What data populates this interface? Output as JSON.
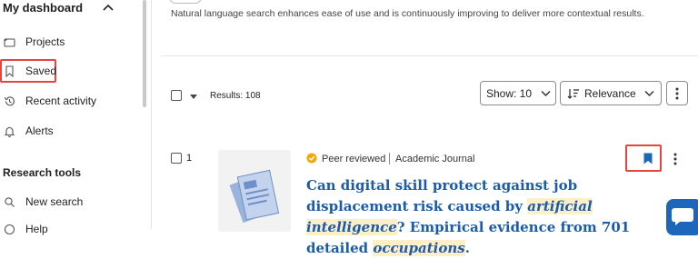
{
  "sidebar": {
    "heading": "My dashboard",
    "items": [
      {
        "label": "Projects",
        "icon": "folder-icon"
      },
      {
        "label": "Saved",
        "icon": "bookmark-icon"
      },
      {
        "label": "Recent activity",
        "icon": "history-icon"
      },
      {
        "label": "Alerts",
        "icon": "bell-icon"
      }
    ],
    "section_title": "Research tools",
    "tools": [
      {
        "label": "New search",
        "icon": "search-icon"
      },
      {
        "label": "Help",
        "icon": "help-icon"
      }
    ]
  },
  "main": {
    "nl_note": "Natural language search enhances ease of use and is continuously improving to deliver more contextual results.",
    "results_label": "Results: 108",
    "show_label": "Show: 10",
    "sort_label": "Relevance"
  },
  "result": {
    "number": "1",
    "peer_reviewed": "Peer reviewed",
    "type": "Academic Journal",
    "title_parts": [
      "Can digital skill protect against job displacement risk caused by ",
      "artificial",
      " ",
      "intelligence",
      "? Empirical evidence from 701 detailed ",
      "occupations",
      "."
    ]
  },
  "colors": {
    "accent": "#1a5bab",
    "highlight_box": "#e2473f",
    "term_highlight": "#fdefc8",
    "peer_badge": "#f2a900"
  }
}
